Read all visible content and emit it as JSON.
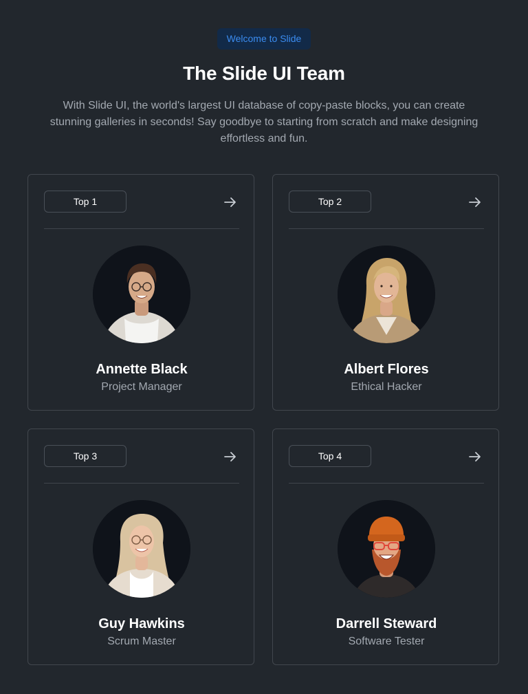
{
  "header": {
    "badge": "Welcome to Slide",
    "title": "The Slide UI Team",
    "subtitle": "With Slide UI, the world's largest UI database of copy-paste blocks, you can create stunning galleries in seconds! Say goodbye to starting from scratch and make designing effortless and fun."
  },
  "colors": {
    "background": "#22272d",
    "badge_bg": "#122a48",
    "badge_text": "#3b8cf0",
    "card_border": "#42474e",
    "muted_text": "#a3a9b1"
  },
  "team": [
    {
      "rank": "Top 1",
      "name": "Annette Black",
      "role": "Project Manager",
      "icon": "arrow-right-icon"
    },
    {
      "rank": "Top 2",
      "name": "Albert Flores",
      "role": "Ethical Hacker",
      "icon": "arrow-right-icon"
    },
    {
      "rank": "Top 3",
      "name": "Guy Hawkins",
      "role": "Scrum Master",
      "icon": "arrow-right-icon"
    },
    {
      "rank": "Top 4",
      "name": "Darrell Steward",
      "role": "Software Tester",
      "icon": "arrow-right-icon"
    }
  ]
}
